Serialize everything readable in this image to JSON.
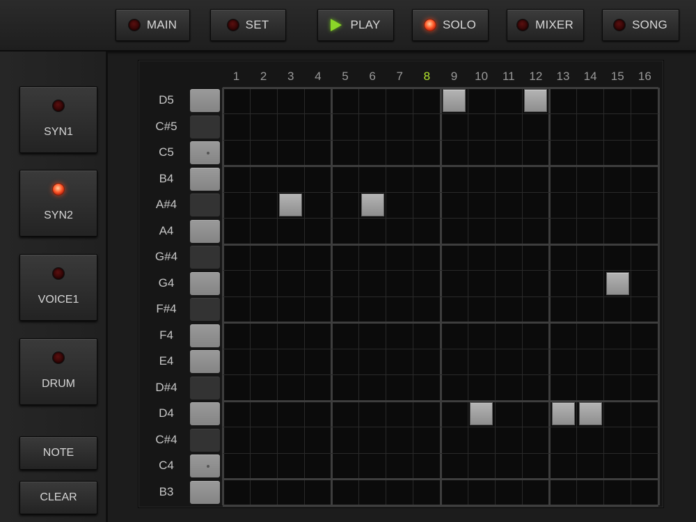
{
  "top_buttons": [
    {
      "label": "MAIN",
      "indicator": "led-off"
    },
    {
      "label": "SET",
      "indicator": "led-off"
    },
    {
      "label": "PLAY",
      "indicator": "play-icon"
    },
    {
      "label": "SOLO",
      "indicator": "led-on"
    },
    {
      "label": "MIXER",
      "indicator": "led-off"
    },
    {
      "label": "SONG",
      "indicator": "led-off"
    }
  ],
  "tracks": [
    {
      "label": "SYN1",
      "active": false
    },
    {
      "label": "SYN2",
      "active": true
    },
    {
      "label": "VOICE1",
      "active": false
    },
    {
      "label": "DRUM",
      "active": false
    }
  ],
  "tool_buttons": [
    "NOTE",
    "CLEAR"
  ],
  "steps": [
    "1",
    "2",
    "3",
    "4",
    "5",
    "6",
    "7",
    "8",
    "9",
    "10",
    "11",
    "12",
    "13",
    "14",
    "15",
    "16"
  ],
  "current_step": "8",
  "notes": [
    "D5",
    "C#5",
    "C5",
    "B4",
    "A#4",
    "A4",
    "G#4",
    "G4",
    "F#4",
    "F4",
    "E4",
    "D#4",
    "D4",
    "C#4",
    "C4",
    "B3"
  ],
  "active_cells": [
    {
      "note": "D5",
      "step": 9
    },
    {
      "note": "D5",
      "step": 12
    },
    {
      "note": "A#4",
      "step": 3
    },
    {
      "note": "A#4",
      "step": 6
    },
    {
      "note": "G4",
      "step": 15
    },
    {
      "note": "D4",
      "step": 10
    },
    {
      "note": "D4",
      "step": 13
    },
    {
      "note": "D4",
      "step": 14
    }
  ],
  "colors": {
    "led_on": "#ff5a2a",
    "play_icon": "#8cd628",
    "current_step": "#b6e82e",
    "active_cell": "#a8a8a8"
  }
}
